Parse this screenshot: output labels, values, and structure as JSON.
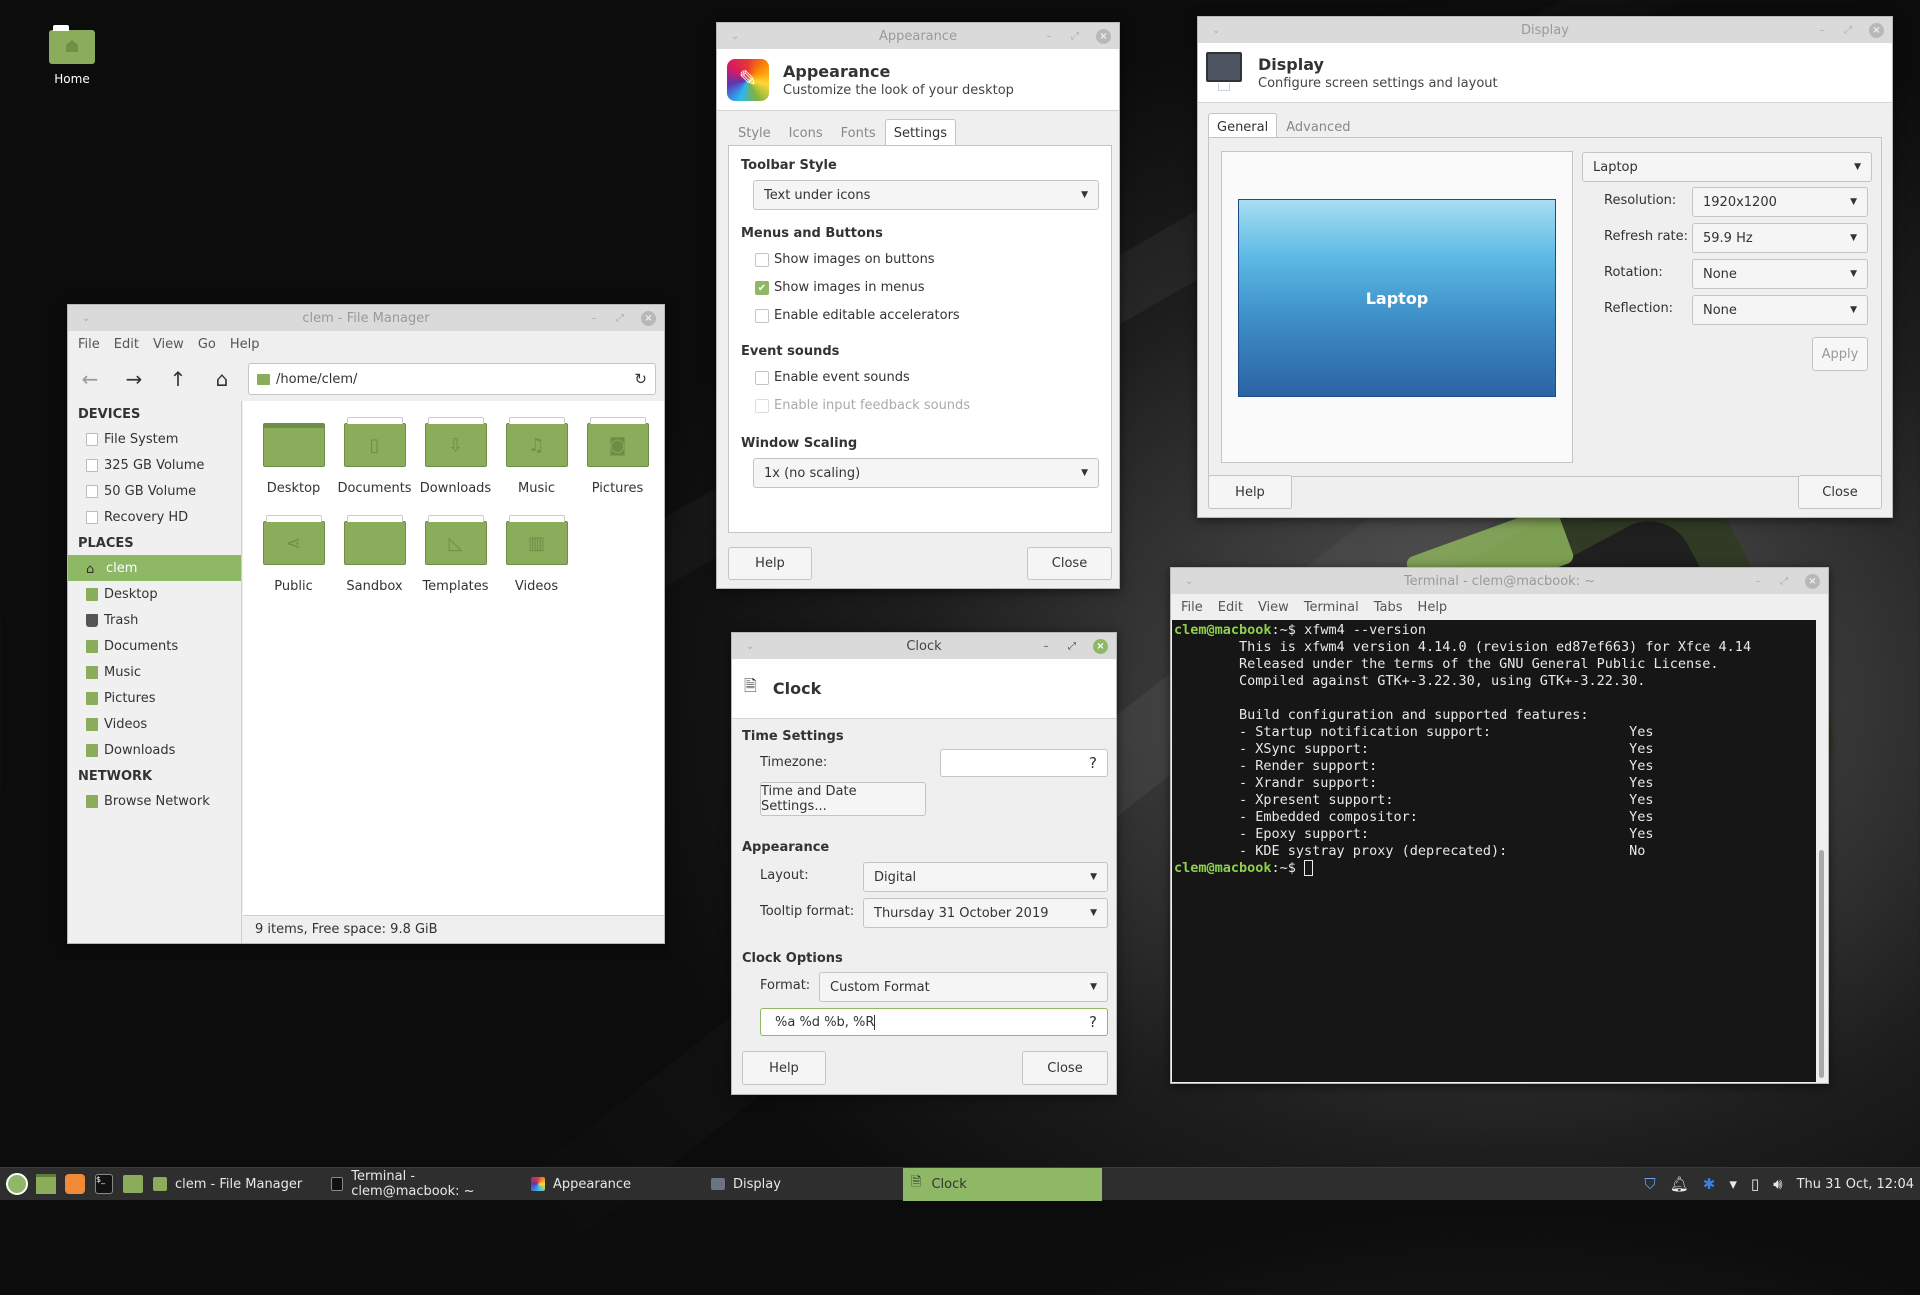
{
  "desktop": {
    "icons": [
      {
        "label": "Home",
        "icon": "home-folder-icon"
      }
    ]
  },
  "file_manager": {
    "title": "clem - File Manager",
    "menu": [
      "File",
      "Edit",
      "View",
      "Go",
      "Help"
    ],
    "path": "/home/clem/",
    "sidebar": {
      "devices_header": "DEVICES",
      "devices": [
        "File System",
        "325 GB Volume",
        "50 GB Volume",
        "Recovery HD"
      ],
      "places_header": "PLACES",
      "places": [
        {
          "label": "clem",
          "selected": true
        },
        {
          "label": "Desktop"
        },
        {
          "label": "Trash"
        },
        {
          "label": "Documents"
        },
        {
          "label": "Music"
        },
        {
          "label": "Pictures"
        },
        {
          "label": "Videos"
        },
        {
          "label": "Downloads"
        }
      ],
      "network_header": "NETWORK",
      "network": [
        "Browse Network"
      ]
    },
    "files": [
      {
        "name": "Desktop",
        "glyph": ""
      },
      {
        "name": "Documents",
        "glyph": "▯"
      },
      {
        "name": "Downloads",
        "glyph": "⇩"
      },
      {
        "name": "Music",
        "glyph": "♫"
      },
      {
        "name": "Pictures",
        "glyph": "◙"
      },
      {
        "name": "Public",
        "glyph": "⋖"
      },
      {
        "name": "Sandbox",
        "glyph": ""
      },
      {
        "name": "Templates",
        "glyph": "◺"
      },
      {
        "name": "Videos",
        "glyph": "▥"
      }
    ],
    "status": "9 items, Free space: 9.8 GiB"
  },
  "appearance": {
    "window_title": "Appearance",
    "title": "Appearance",
    "subtitle": "Customize the look of your desktop",
    "tabs": [
      "Style",
      "Icons",
      "Fonts",
      "Settings"
    ],
    "active_tab": "Settings",
    "toolbar_style_header": "Toolbar Style",
    "toolbar_style_value": "Text under icons",
    "menus_header": "Menus and Buttons",
    "menus_options": [
      {
        "label": "Show images on buttons",
        "checked": false
      },
      {
        "label": "Show images in menus",
        "checked": true
      },
      {
        "label": "Enable editable accelerators",
        "checked": false
      }
    ],
    "sounds_header": "Event sounds",
    "sounds_options": [
      {
        "label": "Enable event sounds",
        "checked": false,
        "disabled": false
      },
      {
        "label": "Enable input feedback sounds",
        "checked": false,
        "disabled": true
      }
    ],
    "scaling_header": "Window Scaling",
    "scaling_value": "1x (no scaling)",
    "help_label": "Help",
    "close_label": "Close"
  },
  "display": {
    "window_title": "Display",
    "title": "Display",
    "subtitle": "Configure screen settings and layout",
    "tabs": [
      "General",
      "Advanced"
    ],
    "active_tab": "General",
    "monitor_label": "Laptop",
    "output_select": "Laptop",
    "resolution_label": "Resolution:",
    "resolution_value": "1920x1200",
    "refresh_label": "Refresh rate:",
    "refresh_value": "59.9 Hz",
    "rotation_label": "Rotation:",
    "rotation_value": "None",
    "reflection_label": "Reflection:",
    "reflection_value": "None",
    "apply_label": "Apply",
    "help_label": "Help",
    "close_label": "Close"
  },
  "clock": {
    "window_title": "Clock",
    "title": "Clock",
    "time_settings_header": "Time Settings",
    "timezone_label": "Timezone:",
    "timezone_value": "",
    "timezone_help": "?",
    "time_date_button": "Time and Date Settings...",
    "appearance_header": "Appearance",
    "layout_label": "Layout:",
    "layout_value": "Digital",
    "tooltip_label": "Tooltip format:",
    "tooltip_value": "Thursday 31 October 2019",
    "clock_options_header": "Clock Options",
    "format_label": "Format:",
    "format_value": "Custom Format",
    "custom_format_value": "%a %d %b, %R",
    "custom_format_help": "?",
    "help_label": "Help",
    "close_label": "Close"
  },
  "terminal": {
    "window_title": "Terminal - clem@macbook: ~",
    "menu": [
      "File",
      "Edit",
      "View",
      "Terminal",
      "Tabs",
      "Help"
    ],
    "prompt_user": "clem@macbook",
    "prompt_path": ":~$ ",
    "command": "xfwm4 --version",
    "output": [
      "        This is xfwm4 version 4.14.0 (revision ed87ef663) for Xfce 4.14",
      "        Released under the terms of the GNU General Public License.",
      "        Compiled against GTK+-3.22.30, using GTK+-3.22.30.",
      "",
      "        Build configuration and supported features:",
      "        - Startup notification support:                 Yes",
      "        - XSync support:                                Yes",
      "        - Render support:                               Yes",
      "        - Xrandr support:                               Yes",
      "        - Xpresent support:                             Yes",
      "        - Embedded compositor:                          Yes",
      "        - Epoxy support:                                Yes",
      "        - KDE systray proxy (deprecated):               No"
    ]
  },
  "taskbar": {
    "launchers": [
      "mint-menu-icon",
      "show-desktop-icon",
      "firefox-icon",
      "terminal-icon",
      "files-icon"
    ],
    "tasks": [
      {
        "label": "clem - File Manager",
        "active": false
      },
      {
        "label": "Terminal - clem@macbook: ~",
        "active": false
      },
      {
        "label": "Appearance",
        "active": false
      },
      {
        "label": "Display",
        "active": false
      },
      {
        "label": "Clock",
        "active": true
      }
    ],
    "tray": [
      "shield-update-icon",
      "notification-bell-icon",
      "bluetooth-icon",
      "network-wifi-icon",
      "battery-icon",
      "volume-icon"
    ],
    "clock": "Thu 31 Oct, 12:04"
  },
  "colors": {
    "accent": "#8fb866",
    "folder": "#8aac5b",
    "taskbar": "#2e2e2e",
    "terminal_bg": "#161616",
    "prompt": "#8ed04d"
  }
}
